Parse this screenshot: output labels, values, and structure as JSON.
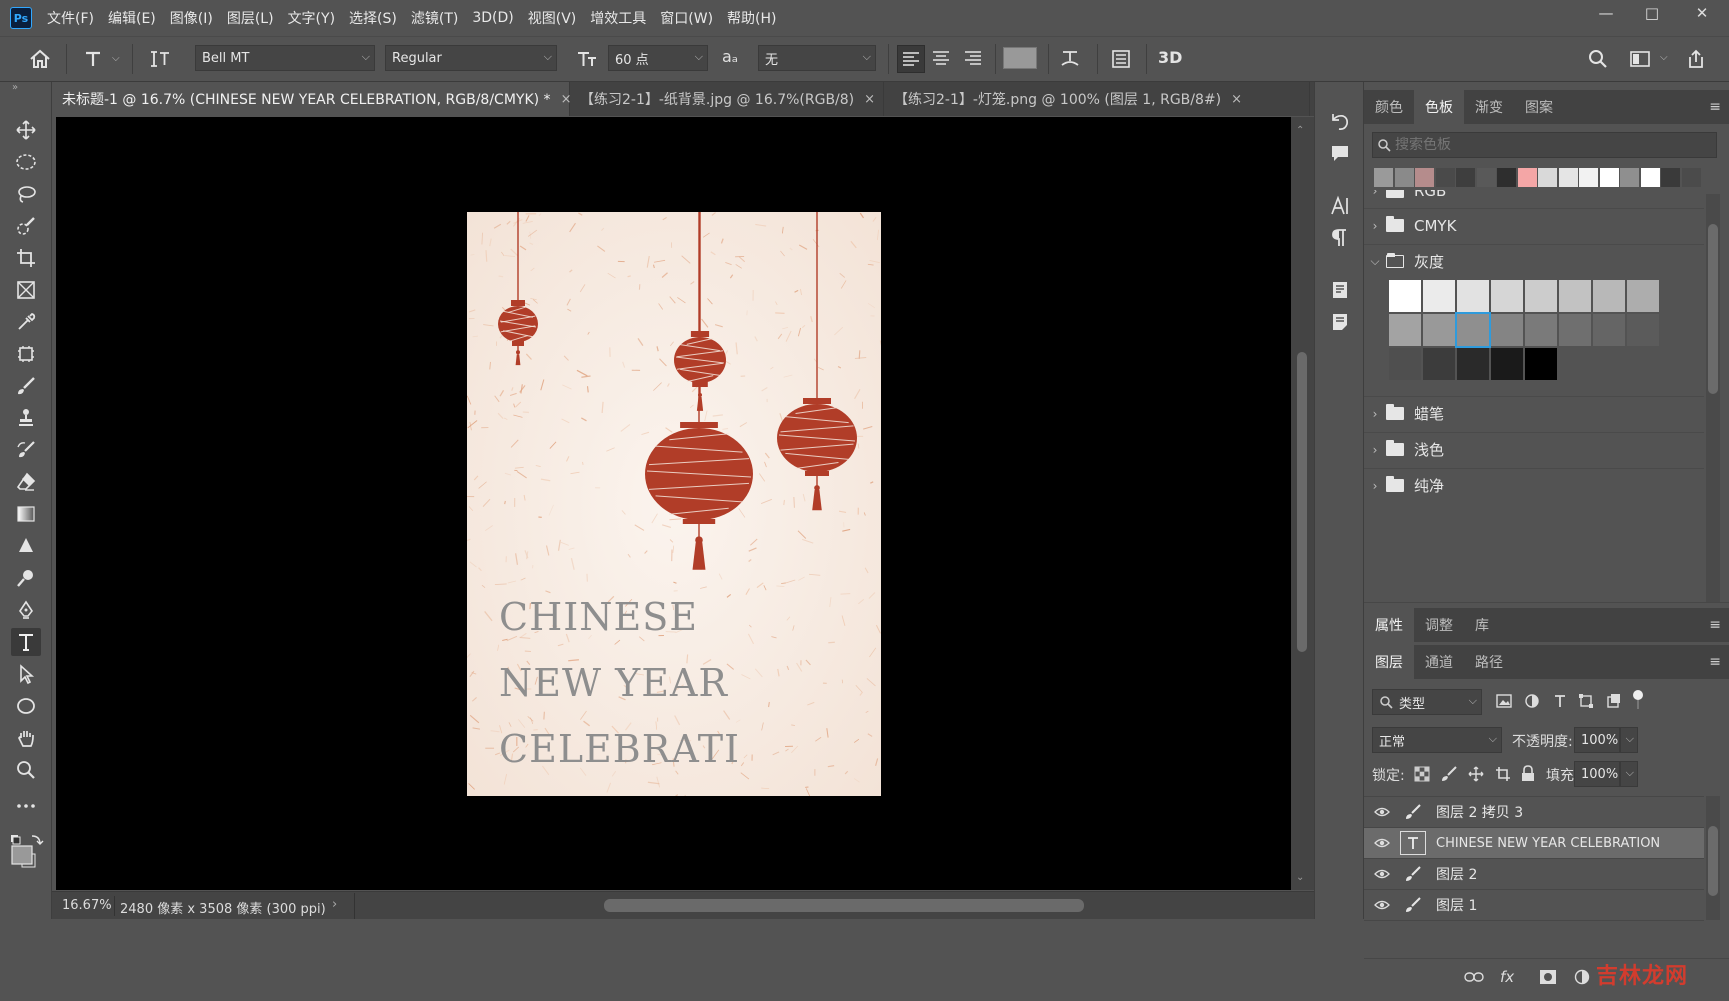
{
  "app": {
    "logo": "Ps"
  },
  "menu": [
    "文件(F)",
    "编辑(E)",
    "图像(I)",
    "图层(L)",
    "文字(Y)",
    "选择(S)",
    "滤镜(T)",
    "3D(D)",
    "视图(V)",
    "增效工具",
    "窗口(W)",
    "帮助(H)"
  ],
  "window_controls": {
    "minimize": "—",
    "maximize": "□",
    "close": "✕"
  },
  "options": {
    "font_family": "Bell MT",
    "font_style": "Regular",
    "font_size": "60 点",
    "aa_label": "aₐ",
    "antialias": "无",
    "dropdown_glyph": "⌵",
    "three_d": "3D"
  },
  "tabs": [
    {
      "label": "未标题-1 @ 16.7% (CHINESE NEW YEAR CELEBRATION, RGB/8/CMYK) *",
      "close": "×"
    },
    {
      "label": "【练习2-1】-纸背景.jpg @ 16.7%(RGB/8)",
      "close": "×"
    },
    {
      "label": "【练习2-1】-灯笼.png @ 100% (图层 1, RGB/8#)",
      "close": "×"
    }
  ],
  "document": {
    "text_lines": [
      "CHINESE",
      "NEW YEAR",
      "CELEBRATI"
    ],
    "lantern_color": "#b13d28",
    "paper_color": "#f7ece4",
    "text_color": "#8e8e8e"
  },
  "status": {
    "zoom": "16.67%",
    "size": "2480 像素 x 3508 像素 (300 ppi)",
    "arrow": "›"
  },
  "swatches_panel": {
    "tabs": [
      "颜色",
      "色板",
      "渐变",
      "图案"
    ],
    "active_tab": "色板",
    "search_placeholder": "搜索色板",
    "recent": [
      "#9a9a9a",
      "#8a8a8a",
      "#b58c8c",
      "#4a4a4a",
      "#3e3e3e",
      "#595959",
      "#2e2e2e",
      "#f4a6a6",
      "#d9d9d9",
      "#e5e5e5",
      "#f2f2f2",
      "#ffffff",
      "#8f8f8f",
      "#ffffff",
      "#3a3a3a",
      "#4b4b4b"
    ],
    "groups": [
      "RGB",
      "CMYK",
      "灰度",
      "蜡笔",
      "浅色",
      "纯净"
    ],
    "grays": [
      "#ffffff",
      "#ebebeb",
      "#e2e2e2",
      "#d6d6d6",
      "#cccccc",
      "#c2c2c2",
      "#b8b8b8",
      "#adadad",
      "#a3a3a3",
      "#999999",
      "#8f8f8f",
      "#848484",
      "#7a7a7a",
      "#6f6f6f",
      "#656565",
      "#5b5b5b",
      "#4f4f4f",
      "#3c3c3c",
      "#2a2a2a",
      "#1a1a1a",
      "#000000"
    ],
    "selected_gray_index": 10
  },
  "props_panel": {
    "tabs": [
      "属性",
      "调整",
      "库"
    ],
    "active_tab": "属性"
  },
  "layers_panel": {
    "tabs": [
      "图层",
      "通道",
      "路径"
    ],
    "active_tab": "图层",
    "filter_label": "类型",
    "blend_mode": "正常",
    "opacity_label": "不透明度:",
    "opacity_value": "100%",
    "lock_label": "锁定:",
    "fill_label": "填充:",
    "fill_value": "100%",
    "layers": [
      {
        "name": "图层 2 拷贝 3",
        "type": "brush",
        "selected": false
      },
      {
        "name": "CHINESE NEW YEAR CELEBRATION",
        "type": "text",
        "selected": true
      },
      {
        "name": "图层 2",
        "type": "brush",
        "selected": false
      },
      {
        "name": "图层 1",
        "type": "brush",
        "selected": false
      }
    ],
    "footer_icons": [
      "link-icon",
      "fx-icon",
      "mask-icon",
      "adjustment-icon"
    ],
    "fx_label": "fx"
  },
  "watermark": "吉林龙网"
}
